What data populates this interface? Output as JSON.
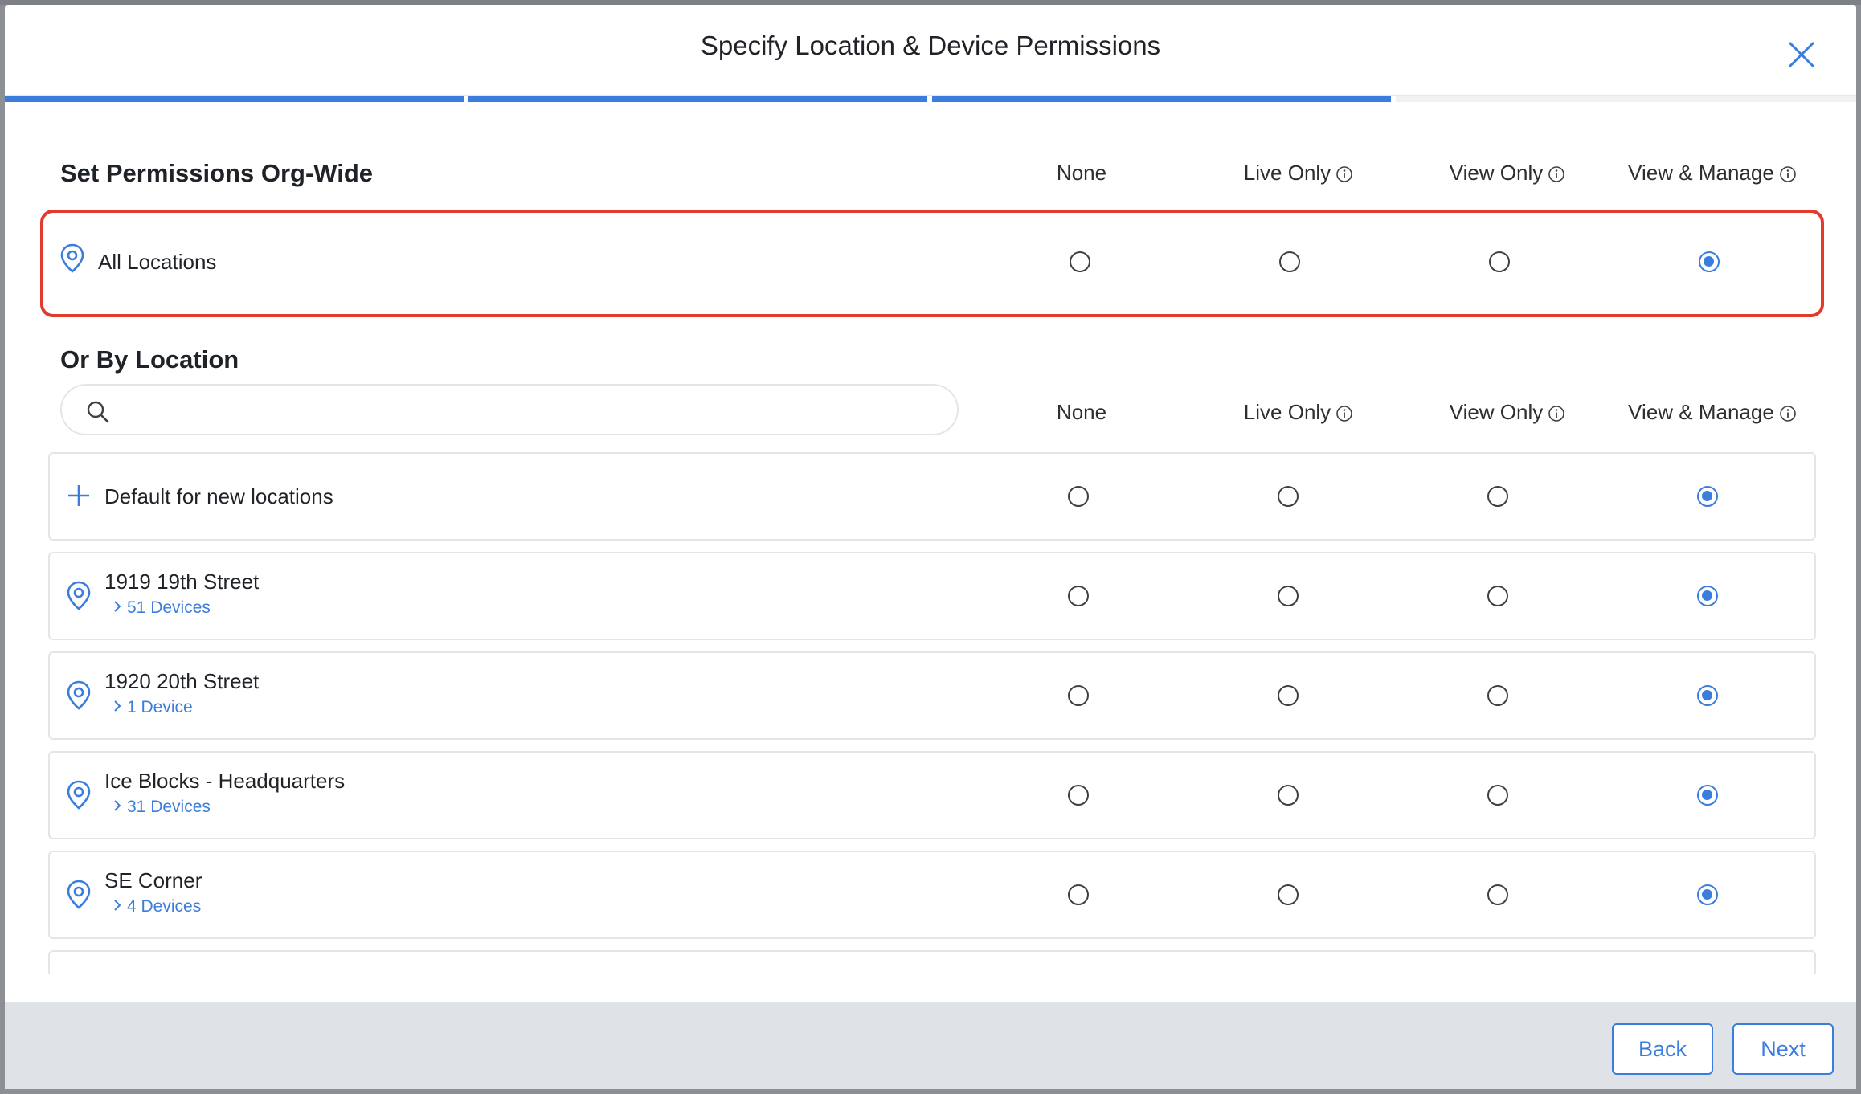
{
  "modal": {
    "title": "Specify Location & Device Permissions"
  },
  "progress": {
    "completed_steps": 3,
    "total_steps": 4
  },
  "org_wide": {
    "title": "Set Permissions Org-Wide",
    "columns": [
      "None",
      "Live Only",
      "View Only",
      "View & Manage"
    ],
    "row": {
      "label": "All Locations",
      "selected": "View & Manage"
    }
  },
  "by_location": {
    "title": "Or By Location",
    "search": {
      "placeholder": "",
      "value": ""
    },
    "columns": [
      "None",
      "Live Only",
      "View Only",
      "View & Manage"
    ],
    "default_row": {
      "label": "Default for new locations",
      "selected": "View & Manage"
    },
    "locations": [
      {
        "name": "1919 19th Street",
        "devices": "51 Devices",
        "selected": "View & Manage"
      },
      {
        "name": "1920 20th Street",
        "devices": "1 Device",
        "selected": "View & Manage"
      },
      {
        "name": "Ice Blocks - Headquarters",
        "devices": "31 Devices",
        "selected": "View & Manage"
      },
      {
        "name": "SE Corner",
        "devices": "4 Devices",
        "selected": "View & Manage"
      }
    ]
  },
  "footer": {
    "back_label": "Back",
    "next_label": "Next"
  },
  "colors": {
    "accent": "#3b7ddd",
    "highlight": "#e23b2e"
  }
}
